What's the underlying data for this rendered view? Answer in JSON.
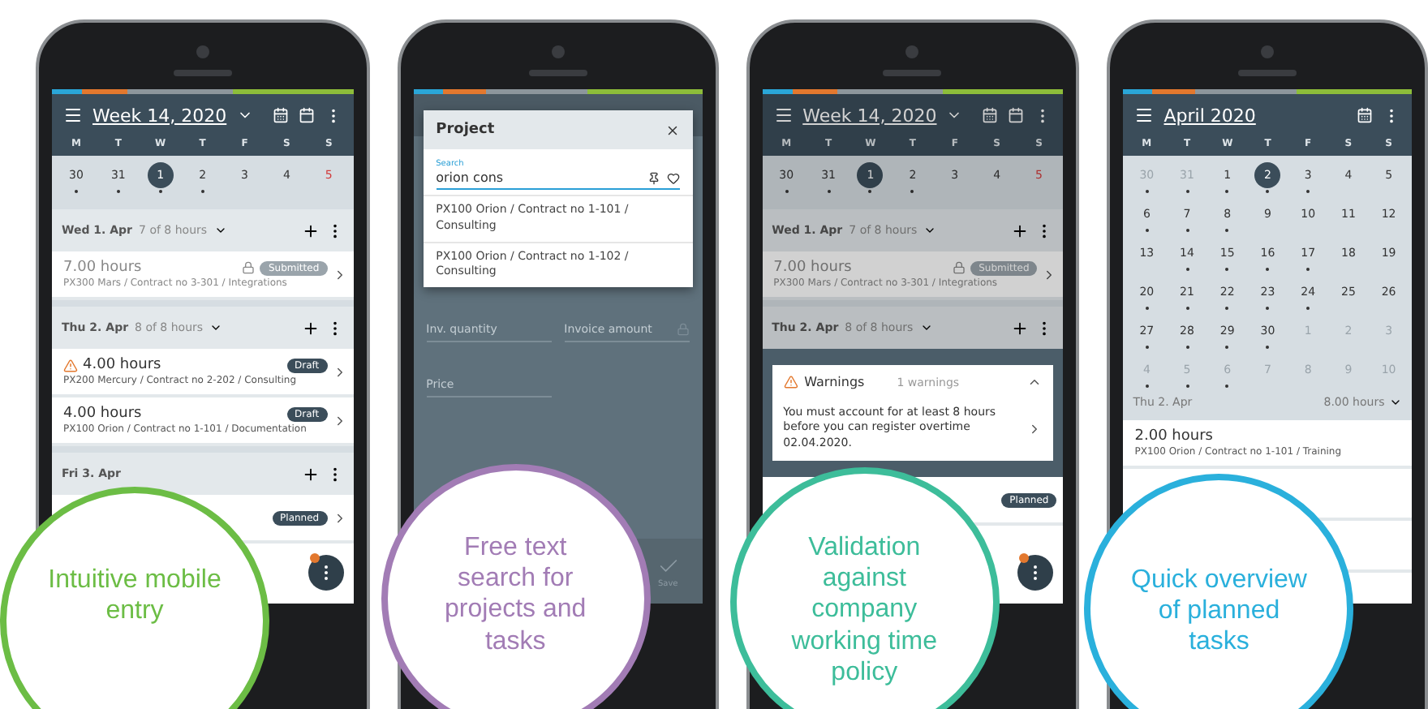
{
  "phones": [
    {
      "kind": "week",
      "title": "Week 14, 2020",
      "dimmed": false,
      "weekdays": [
        "M",
        "T",
        "W",
        "T",
        "F",
        "S",
        "S"
      ],
      "days": [
        {
          "label": "30",
          "selected": false,
          "dot": true,
          "holiday": false
        },
        {
          "label": "31",
          "selected": false,
          "dot": true,
          "holiday": false
        },
        {
          "label": "1",
          "selected": true,
          "dot": true,
          "holiday": false
        },
        {
          "label": "2",
          "selected": false,
          "dot": true,
          "holiday": false
        },
        {
          "label": "3",
          "selected": false,
          "dot": false,
          "holiday": false
        },
        {
          "label": "4",
          "selected": false,
          "dot": false,
          "holiday": false
        },
        {
          "label": "5",
          "selected": false,
          "dot": false,
          "holiday": true
        }
      ],
      "groups": [
        {
          "date": "Wed 1. Apr",
          "hours": "7 of 8 hours",
          "entries": [
            {
              "hours": "7.00 hours",
              "path": "PX300 Mars / Contract no 3-301 / Integrations",
              "status": "Submitted",
              "kind": "submitted",
              "locked": true,
              "warning": false
            }
          ]
        },
        {
          "date": "Thu 2. Apr",
          "hours": "8 of 8 hours",
          "entries": [
            {
              "hours": "4.00 hours",
              "path": "PX200 Mercury / Contract no 2-202 / Consulting",
              "status": "Draft",
              "kind": "draft",
              "locked": false,
              "warning": true
            },
            {
              "hours": "4.00 hours",
              "path": "PX100 Orion / Contract no 1-101 / Documentation",
              "status": "Draft",
              "kind": "draft",
              "locked": false,
              "warning": false
            }
          ]
        },
        {
          "date": "Fri 3. Apr",
          "entries": [
            {
              "status": "Planned",
              "kind": "planned",
              "locked": false,
              "warning": false
            }
          ]
        }
      ],
      "callout": {
        "text": "Intuitive mobile entry",
        "color": "#6cbd45"
      }
    },
    {
      "kind": "form",
      "dialog": {
        "title": "Project",
        "search_label": "Search",
        "search_value": "orion cons",
        "results": [
          "PX100 Orion / Contract no 1-101 / Consulting",
          "PX100 Orion / Contract no 1-102 / Consulting"
        ]
      },
      "fields": [
        {
          "placeholder": "Inv. quantity",
          "locked": false
        },
        {
          "placeholder": "Invoice amount",
          "locked": true
        },
        {
          "placeholder": "Price",
          "locked": false
        }
      ],
      "save": "Save",
      "callout": {
        "text": "Free text search for projects and tasks",
        "color": "#a27cb5"
      }
    },
    {
      "kind": "week",
      "title": "Week 14, 2020",
      "dimmed": true,
      "weekdays": [
        "M",
        "T",
        "W",
        "T",
        "F",
        "S",
        "S"
      ],
      "days": [
        {
          "label": "30",
          "selected": false,
          "dot": true,
          "holiday": false
        },
        {
          "label": "31",
          "selected": false,
          "dot": true,
          "holiday": false
        },
        {
          "label": "1",
          "selected": true,
          "dot": true,
          "holiday": false
        },
        {
          "label": "2",
          "selected": false,
          "dot": true,
          "holiday": false
        },
        {
          "label": "3",
          "selected": false,
          "dot": false,
          "holiday": false
        },
        {
          "label": "4",
          "selected": false,
          "dot": false,
          "holiday": false
        },
        {
          "label": "5",
          "selected": false,
          "dot": false,
          "holiday": true
        }
      ],
      "groups": [
        {
          "date": "Wed 1. Apr",
          "hours": "7 of 8 hours",
          "entries": [
            {
              "hours": "7.00 hours",
              "path": "PX300 Mars / Contract no 3-301 / Integrations",
              "status": "Submitted",
              "kind": "submitted",
              "locked": true,
              "warning": false
            }
          ]
        },
        {
          "date": "Thu 2. Apr",
          "hours": "8 of 8 hours"
        }
      ],
      "warnings": {
        "title": "Warnings",
        "count": "1 warnings",
        "message": "You must account for at least 8 hours before you can register overtime 02.04.2020."
      },
      "trailing": {
        "status": "Planned",
        "kind": "planned"
      },
      "callout": {
        "text": "Validation against company working time policy",
        "color": "#3dbd9a"
      }
    },
    {
      "kind": "month",
      "title": "April 2020",
      "weekdays": [
        "M",
        "T",
        "W",
        "T",
        "F",
        "S",
        "S"
      ],
      "days": [
        {
          "label": "30",
          "muted": true,
          "dot": true,
          "selected": false
        },
        {
          "label": "31",
          "muted": true,
          "dot": true,
          "selected": false
        },
        {
          "label": "1",
          "muted": false,
          "dot": true,
          "selected": false
        },
        {
          "label": "2",
          "muted": false,
          "dot": true,
          "selected": true
        },
        {
          "label": "3",
          "muted": false,
          "dot": true,
          "selected": false
        },
        {
          "label": "4",
          "muted": false,
          "dot": false,
          "selected": false
        },
        {
          "label": "5",
          "muted": false,
          "dot": false,
          "selected": false
        },
        {
          "label": "6",
          "muted": false,
          "dot": true,
          "selected": false
        },
        {
          "label": "7",
          "muted": false,
          "dot": true,
          "selected": false
        },
        {
          "label": "8",
          "muted": false,
          "dot": true,
          "selected": false
        },
        {
          "label": "9",
          "muted": false,
          "dot": false,
          "selected": false
        },
        {
          "label": "10",
          "muted": false,
          "dot": false,
          "selected": false
        },
        {
          "label": "11",
          "muted": false,
          "dot": false,
          "selected": false
        },
        {
          "label": "12",
          "muted": false,
          "dot": false,
          "selected": false
        },
        {
          "label": "13",
          "muted": false,
          "dot": false,
          "selected": false
        },
        {
          "label": "14",
          "muted": false,
          "dot": true,
          "selected": false
        },
        {
          "label": "15",
          "muted": false,
          "dot": true,
          "selected": false
        },
        {
          "label": "16",
          "muted": false,
          "dot": true,
          "selected": false
        },
        {
          "label": "17",
          "muted": false,
          "dot": true,
          "selected": false
        },
        {
          "label": "18",
          "muted": false,
          "dot": false,
          "selected": false
        },
        {
          "label": "19",
          "muted": false,
          "dot": false,
          "selected": false
        },
        {
          "label": "20",
          "muted": false,
          "dot": true,
          "selected": false
        },
        {
          "label": "21",
          "muted": false,
          "dot": true,
          "selected": false
        },
        {
          "label": "22",
          "muted": false,
          "dot": true,
          "selected": false
        },
        {
          "label": "23",
          "muted": false,
          "dot": true,
          "selected": false
        },
        {
          "label": "24",
          "muted": false,
          "dot": true,
          "selected": false
        },
        {
          "label": "25",
          "muted": false,
          "dot": false,
          "selected": false
        },
        {
          "label": "26",
          "muted": false,
          "dot": false,
          "selected": false
        },
        {
          "label": "27",
          "muted": false,
          "dot": true,
          "selected": false
        },
        {
          "label": "28",
          "muted": false,
          "dot": true,
          "selected": false
        },
        {
          "label": "29",
          "muted": false,
          "dot": true,
          "selected": false
        },
        {
          "label": "30",
          "muted": false,
          "dot": true,
          "selected": false
        },
        {
          "label": "1",
          "muted": true,
          "dot": false,
          "selected": false
        },
        {
          "label": "2",
          "muted": true,
          "dot": false,
          "selected": false
        },
        {
          "label": "3",
          "muted": true,
          "dot": false,
          "selected": false
        },
        {
          "label": "4",
          "muted": true,
          "dot": true,
          "selected": false
        },
        {
          "label": "5",
          "muted": true,
          "dot": true,
          "selected": false
        },
        {
          "label": "6",
          "muted": true,
          "dot": true,
          "selected": false
        },
        {
          "label": "7",
          "muted": true,
          "dot": false,
          "selected": false
        },
        {
          "label": "8",
          "muted": true,
          "dot": false,
          "selected": false
        },
        {
          "label": "9",
          "muted": true,
          "dot": false,
          "selected": false
        },
        {
          "label": "10",
          "muted": true,
          "dot": false,
          "selected": false
        }
      ],
      "summary": {
        "date": "Thu 2. Apr",
        "hours": "8.00 hours"
      },
      "entries": [
        {
          "hours": "2.00 hours",
          "path": "PX100 Orion / Contract no 1-101 / Training"
        }
      ],
      "callout": {
        "text": "Quick overview of planned tasks",
        "color": "#2ab0dc"
      }
    }
  ]
}
